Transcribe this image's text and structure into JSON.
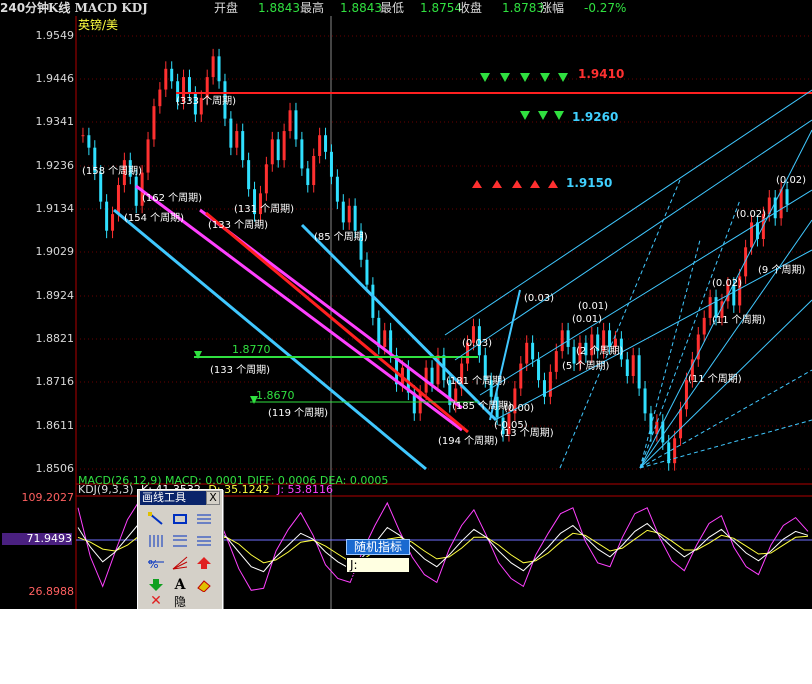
{
  "header": {
    "period": "240分钟",
    "indicators": "K线 MACD KDJ",
    "open_label": "开盘",
    "open_value": "1.8843",
    "high_label": "最高",
    "high_value": "1.8843",
    "low_label": "最低",
    "low_value": "1.8754",
    "close_label": "收盘",
    "close_value": "1.8783",
    "change_label": "涨幅",
    "change_value": "-0.27%"
  },
  "symbol": "英镑/美",
  "price_axis": [
    "1.9549",
    "1.9446",
    "1.9341",
    "1.9236",
    "1.9134",
    "1.9029",
    "1.8924",
    "1.8821",
    "1.8716",
    "1.8611",
    "1.8506"
  ],
  "levels": {
    "red": "1.9410",
    "cyan": "1.9260",
    "cyan2": "1.9150",
    "green1": "1.8770",
    "green2": "1.8670"
  },
  "labels": {
    "l333": "(333 个周期)",
    "l158": "(158 个周期)",
    "l162": "(162 个周期)",
    "l154": "(154 个周期)",
    "l133a": "(133 个周期)",
    "l131": "(131 个周期)",
    "l85": "(85 个周期)",
    "l133b": "(133 个周期)",
    "l119": "(119 个周期)",
    "l181": "(181 个周期)",
    "l185": "(185 个周期)",
    "l194": "(194 个周期)",
    "l13": "(13 个周期)",
    "l5": "(5 个周期)",
    "l2": "(2 个周期)",
    "l11a": "(11 个周期)",
    "l11b": "(11 个周期)",
    "l9": "(9 个周期)",
    "v003": "(0.03)",
    "v001a": "(0.01)",
    "v001b": "(0.01)",
    "v000": "(0.00)",
    "v005": "(-0.05)",
    "v002a": "(0.02)",
    "v002b": "(0.02)",
    "v002c": "(0.02)",
    "v003b": "(0.03)"
  },
  "macd_line": "MACD(26,12,9)  MACD: 0.0001  DIFF: 0.0006  DEA: 0.0005",
  "kdj": {
    "label": "KDJ(9,3,3)",
    "k": "K: 41.3532",
    "d": "D: 35.1242",
    "j": "J: 53.8116",
    "axis": [
      "109.2027",
      "71.9493",
      "26.8988"
    ]
  },
  "toolbox": {
    "title": "画线工具",
    "close": "X"
  },
  "tooltip": {
    "title": "随机指标",
    "value": "J: 53.8116"
  },
  "colors": {
    "bg": "#000000",
    "up": "#ff3030",
    "down": "#30e0ff",
    "level_red": "#ff2020",
    "level_cyan": "#40d0ff",
    "level_green": "#30e040"
  },
  "chart_data": {
    "type": "candlestick",
    "y_range": [
      1.8506,
      1.9549
    ],
    "closes": [
      1.931,
      1.928,
      1.922,
      1.915,
      1.908,
      1.912,
      1.919,
      1.925,
      1.921,
      1.914,
      1.922,
      1.93,
      1.938,
      1.942,
      1.947,
      1.944,
      1.939,
      1.945,
      1.941,
      1.936,
      1.94,
      1.945,
      1.95,
      1.944,
      1.935,
      1.928,
      1.932,
      1.925,
      1.918,
      1.912,
      1.917,
      1.924,
      1.93,
      1.925,
      1.932,
      1.937,
      1.93,
      1.923,
      1.919,
      1.926,
      1.931,
      1.927,
      1.921,
      1.915,
      1.91,
      1.914,
      1.908,
      1.901,
      1.895,
      1.887,
      1.88,
      1.884,
      1.878,
      1.871,
      1.875,
      1.869,
      1.864,
      1.869,
      1.875,
      1.871,
      1.878,
      1.872,
      1.866,
      1.87,
      1.876,
      1.881,
      1.885,
      1.878,
      1.872,
      1.868,
      1.863,
      1.859,
      1.864,
      1.87,
      1.876,
      1.881,
      1.877,
      1.872,
      1.868,
      1.874,
      1.879,
      1.884,
      1.88,
      1.876,
      1.881,
      1.878,
      1.883,
      1.879,
      1.884,
      1.88,
      1.882,
      1.877,
      1.873,
      1.878,
      1.87,
      1.864,
      1.859,
      1.862,
      1.857,
      1.852,
      1.858,
      1.865,
      1.872,
      1.877,
      1.883,
      1.887,
      1.892,
      1.887,
      1.891,
      1.895,
      1.89,
      1.897,
      1.904,
      1.91,
      1.906,
      1.912,
      1.916,
      1.911,
      1.918,
      1.9143
    ],
    "kdj_k": [
      80,
      60,
      45,
      55,
      70,
      85,
      75,
      60,
      40,
      50,
      65,
      78,
      70,
      55,
      40,
      35,
      50,
      62,
      74,
      68,
      55,
      45,
      38,
      50,
      64,
      80,
      72,
      60,
      48,
      40,
      52,
      66,
      78,
      70,
      56,
      44,
      36,
      48,
      60,
      74,
      82,
      70,
      58,
      50,
      62,
      76,
      84,
      72,
      60,
      50,
      58,
      70,
      78,
      66,
      54,
      46,
      56,
      68,
      76,
      72
    ],
    "kdj_d": [
      70,
      65,
      58,
      56,
      62,
      72,
      74,
      68,
      56,
      52,
      58,
      68,
      70,
      63,
      52,
      44,
      47,
      55,
      65,
      67,
      61,
      53,
      45,
      47,
      56,
      68,
      70,
      65,
      56,
      48,
      50,
      59,
      70,
      70,
      62,
      52,
      44,
      46,
      54,
      65,
      74,
      72,
      64,
      56,
      59,
      68,
      77,
      74,
      66,
      57,
      57,
      64,
      72,
      69,
      61,
      53,
      54,
      62,
      70,
      71
    ],
    "kdj_j": [
      100,
      50,
      20,
      55,
      88,
      108,
      78,
      40,
      8,
      46,
      80,
      100,
      70,
      38,
      16,
      18,
      56,
      78,
      95,
      72,
      42,
      28,
      24,
      56,
      82,
      105,
      76,
      50,
      32,
      24,
      58,
      82,
      98,
      72,
      44,
      28,
      20,
      52,
      74,
      94,
      100,
      66,
      44,
      40,
      70,
      94,
      100,
      70,
      46,
      36,
      62,
      84,
      92,
      60,
      40,
      32,
      62,
      82,
      90,
      76
    ]
  }
}
